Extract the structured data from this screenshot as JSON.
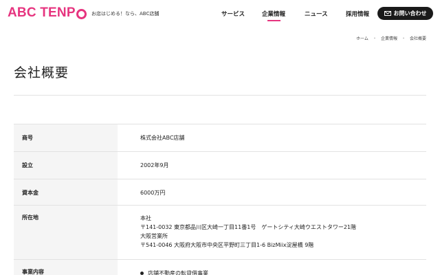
{
  "header": {
    "logo_text": "ABC TENP",
    "tagline": "お店はじめる！なら、ABC店舗",
    "nav": [
      "サービス",
      "企業情報",
      "ニュース",
      "採用情報"
    ],
    "contact_label": "お問い合わせ"
  },
  "breadcrumb": [
    "ホーム",
    "企業情報",
    "会社概要"
  ],
  "page_title": "会社概要",
  "company": {
    "rows": [
      {
        "label": "商号",
        "value": "株式会社ABC店舗"
      },
      {
        "label": "設立",
        "value": "2002年9月"
      },
      {
        "label": "資本金",
        "value": "6000万円"
      },
      {
        "label": "所在地",
        "lines": [
          "本社",
          "〒141-0032 東京都品川区大崎一丁目11番1号　ゲートシティ大崎ウエストタワー21階",
          "大阪営業所",
          "〒541-0046 大阪府大阪市中央区平野町三丁目1-6 BizMiix淀屋橋 9階"
        ]
      },
      {
        "label": "事業内容",
        "items": [
          "店舗不動産の転貸借事業"
        ]
      }
    ]
  },
  "colors": {
    "brand": "#e6347f",
    "button": "#1a1a1a",
    "label_bg": "#f5f5f5"
  }
}
